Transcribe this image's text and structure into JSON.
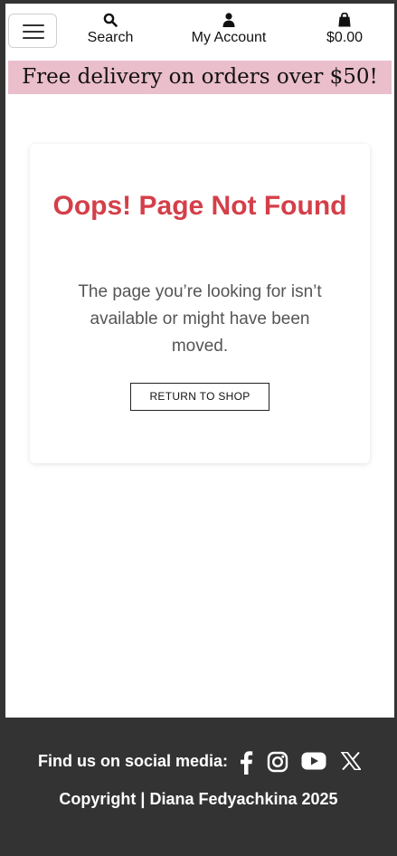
{
  "header": {
    "menu_button_label": "",
    "search_label": "Search",
    "account_label": "My Account",
    "bag_total": "$0.00"
  },
  "banner": {
    "text": "Free delivery on orders over $50!"
  },
  "error_card": {
    "title": "Oops! Page Not Found",
    "message": "The page you’re looking for isn’t available or might have been moved.",
    "return_button_label": "RETURN TO SHOP"
  },
  "footer": {
    "social_label": "Find us on social media:",
    "social_icons": [
      "facebook-icon",
      "instagram-icon",
      "youtube-icon",
      "x-icon"
    ],
    "copyright": "Copyright | Diana Fedyachkina 2025"
  },
  "colors": {
    "banner_bg": "#ebbecb",
    "title_red": "#d43f49",
    "footer_bg": "#333333"
  }
}
